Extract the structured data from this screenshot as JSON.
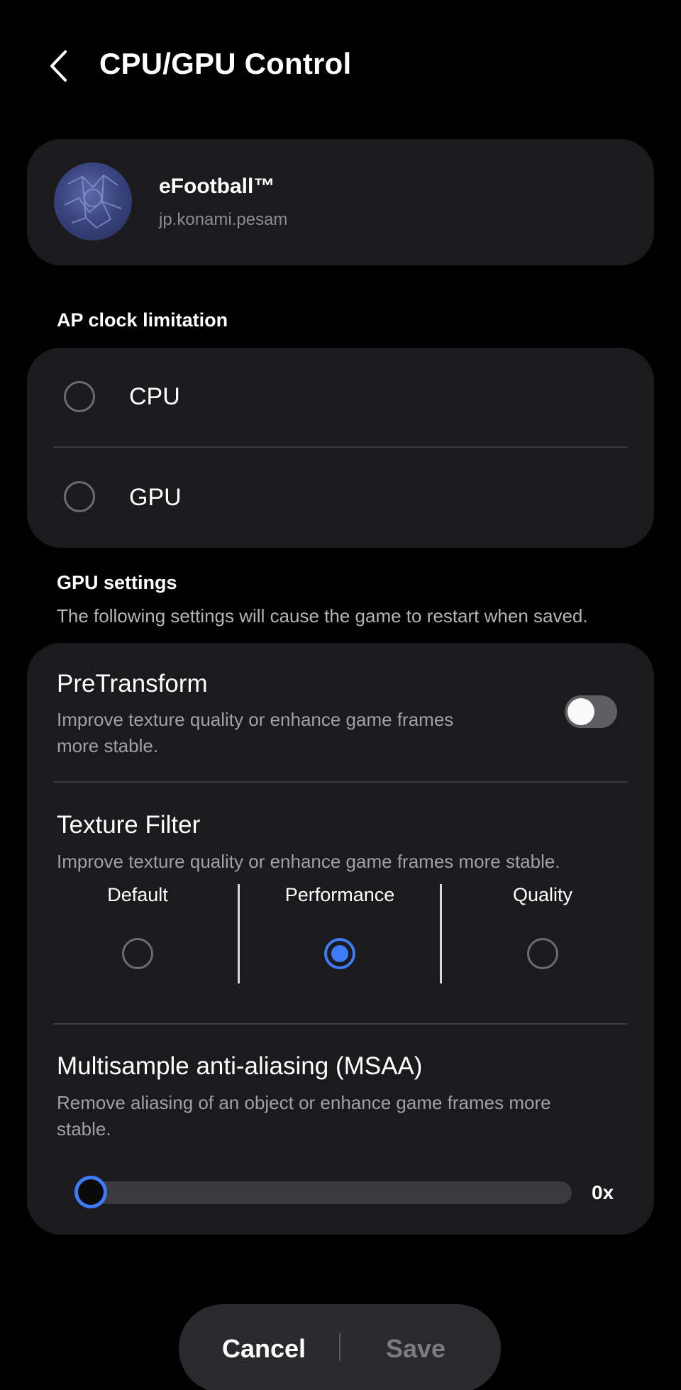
{
  "header": {
    "title": "CPU/GPU Control"
  },
  "app": {
    "name": "eFootball™",
    "package": "jp.konami.pesam"
  },
  "ap_clock": {
    "title": "AP clock limitation",
    "options": [
      {
        "label": "CPU",
        "selected": false
      },
      {
        "label": "GPU",
        "selected": false
      }
    ]
  },
  "gpu_settings": {
    "title": "GPU settings",
    "description": "The following settings will cause the game to restart when saved.",
    "pretransform": {
      "title": "PreTransform",
      "description_line1": "Improve texture quality or enhance game frames",
      "description_line2": "more stable.",
      "enabled": false
    },
    "texture_filter": {
      "title": "Texture Filter",
      "description": "Improve texture quality or enhance game frames more stable.",
      "options": [
        {
          "label": "Default",
          "selected": false
        },
        {
          "label": "Performance",
          "selected": true
        },
        {
          "label": "Quality",
          "selected": false
        }
      ]
    },
    "msaa": {
      "title": "Multisample anti-aliasing (MSAA)",
      "description_line1": "Remove aliasing of an object or enhance game frames more",
      "description_line2": "stable.",
      "value": 0,
      "value_label": "0x"
    }
  },
  "actions": {
    "cancel": "Cancel",
    "save": "Save"
  },
  "colors": {
    "accent": "#3e7bf6",
    "card": "#1b1b1d",
    "background": "#000000"
  }
}
